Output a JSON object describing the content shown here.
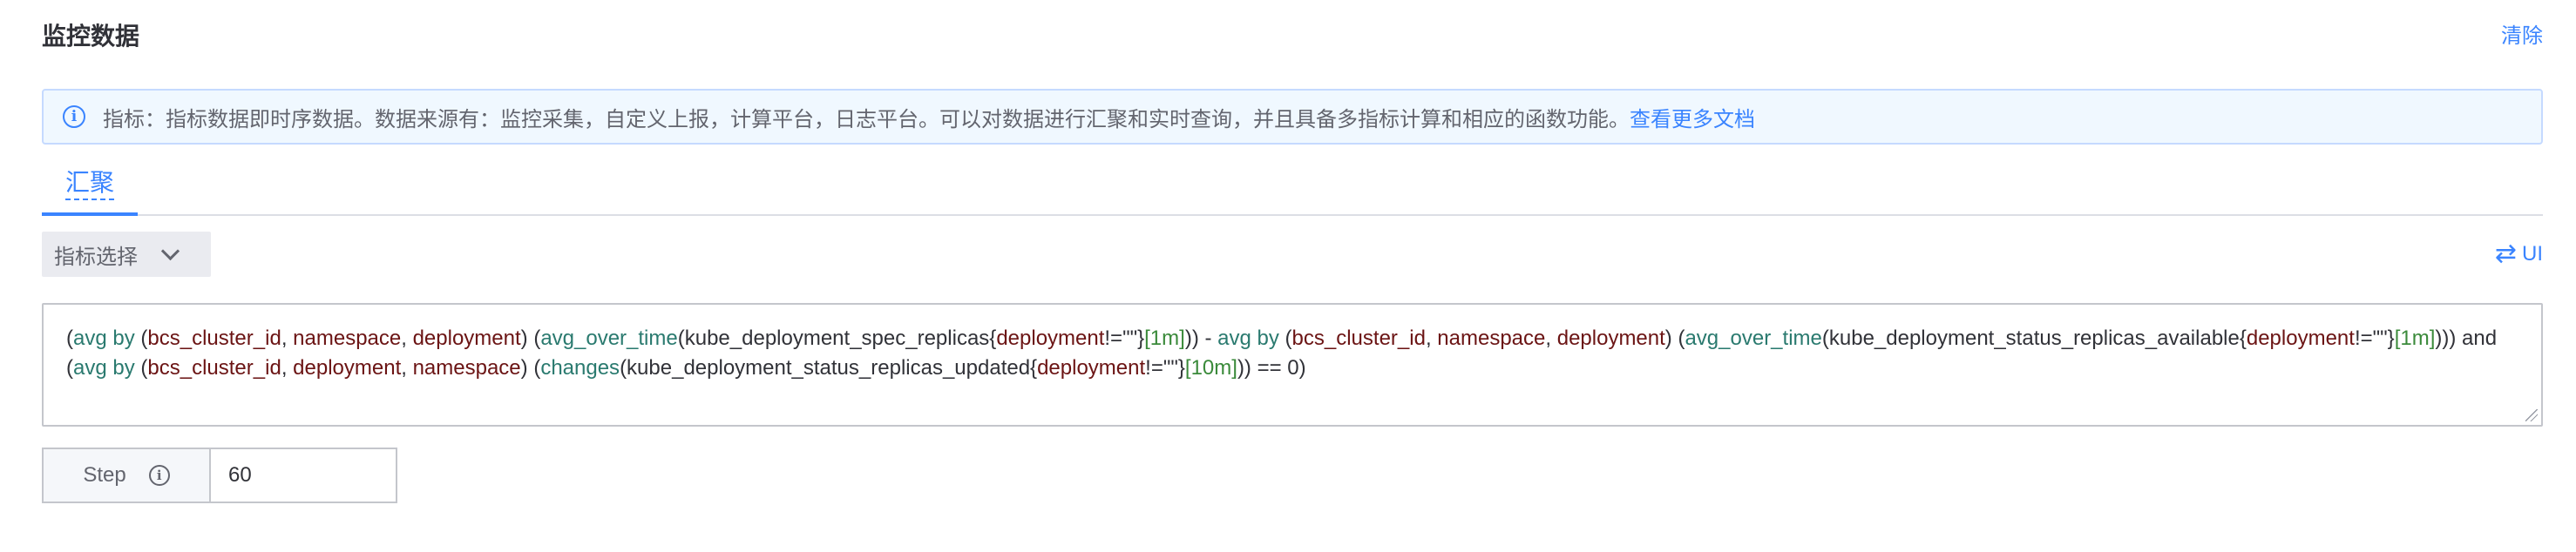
{
  "section": {
    "title": "监控数据",
    "clear_label": "清除"
  },
  "notice": {
    "text": "指标：指标数据即时序数据。数据来源有：监控采集，自定义上报，计算平台，日志平台。可以对数据进行汇聚和实时查询，并且具备多指标计算和相应的函数功能。",
    "link_label": "查看更多文档",
    "icon": "info-circle-icon"
  },
  "tabs": [
    {
      "label": "汇聚",
      "active": true
    }
  ],
  "toolbar": {
    "metric_select_label": "指标选择",
    "metric_select_icon": "chevron-down-icon",
    "mode_toggle_label": "UI",
    "mode_toggle_icon": "swap-arrows-icon"
  },
  "query": {
    "tokens": [
      {
        "t": "(",
        "c": "plain"
      },
      {
        "t": "avg by",
        "c": "func"
      },
      {
        "t": " (",
        "c": "plain"
      },
      {
        "t": "bcs_cluster_id",
        "c": "label"
      },
      {
        "t": ", ",
        "c": "plain"
      },
      {
        "t": "namespace",
        "c": "label"
      },
      {
        "t": ", ",
        "c": "plain"
      },
      {
        "t": "deployment",
        "c": "label"
      },
      {
        "t": ") (",
        "c": "plain"
      },
      {
        "t": "avg_over_time",
        "c": "func"
      },
      {
        "t": "(kube_deployment_spec_replicas{",
        "c": "plain"
      },
      {
        "t": "deployment",
        "c": "label"
      },
      {
        "t": "!=\"\"}",
        "c": "plain"
      },
      {
        "t": "[1m]",
        "c": "num"
      },
      {
        "t": ")) - ",
        "c": "plain"
      },
      {
        "t": "avg by",
        "c": "func"
      },
      {
        "t": " (",
        "c": "plain"
      },
      {
        "t": "bcs_cluster_id",
        "c": "label"
      },
      {
        "t": ", ",
        "c": "plain"
      },
      {
        "t": "namespace",
        "c": "label"
      },
      {
        "t": ", ",
        "c": "plain"
      },
      {
        "t": "deployment",
        "c": "label"
      },
      {
        "t": ") (",
        "c": "plain"
      },
      {
        "t": "avg_over_time",
        "c": "func"
      },
      {
        "t": "(kube_deployment_status_replicas_available{",
        "c": "plain"
      },
      {
        "t": "deployment",
        "c": "label"
      },
      {
        "t": "!=\"\"}",
        "c": "plain"
      },
      {
        "t": "[1m]",
        "c": "num"
      },
      {
        "t": "))) and",
        "c": "plain"
      },
      {
        "t": "\n",
        "c": "br"
      },
      {
        "t": "(",
        "c": "plain"
      },
      {
        "t": "avg by",
        "c": "func"
      },
      {
        "t": " (",
        "c": "plain"
      },
      {
        "t": "bcs_cluster_id",
        "c": "label"
      },
      {
        "t": ", ",
        "c": "plain"
      },
      {
        "t": "deployment",
        "c": "label"
      },
      {
        "t": ", ",
        "c": "plain"
      },
      {
        "t": "namespace",
        "c": "label"
      },
      {
        "t": ") (",
        "c": "plain"
      },
      {
        "t": "changes",
        "c": "func"
      },
      {
        "t": "(kube_deployment_status_replicas_updated{",
        "c": "plain"
      },
      {
        "t": "deployment",
        "c": "label"
      },
      {
        "t": "!=\"\"}",
        "c": "plain"
      },
      {
        "t": "[10m]",
        "c": "num"
      },
      {
        "t": ")) == 0)",
        "c": "plain"
      }
    ]
  },
  "step": {
    "label": "Step",
    "info_icon": "info-circle-icon",
    "value": "60"
  },
  "colors": {
    "accent": "#3a84ff",
    "func": "#2a7a6f",
    "label": "#6b1414",
    "num": "#3a8a3a",
    "plain": "#313238"
  }
}
